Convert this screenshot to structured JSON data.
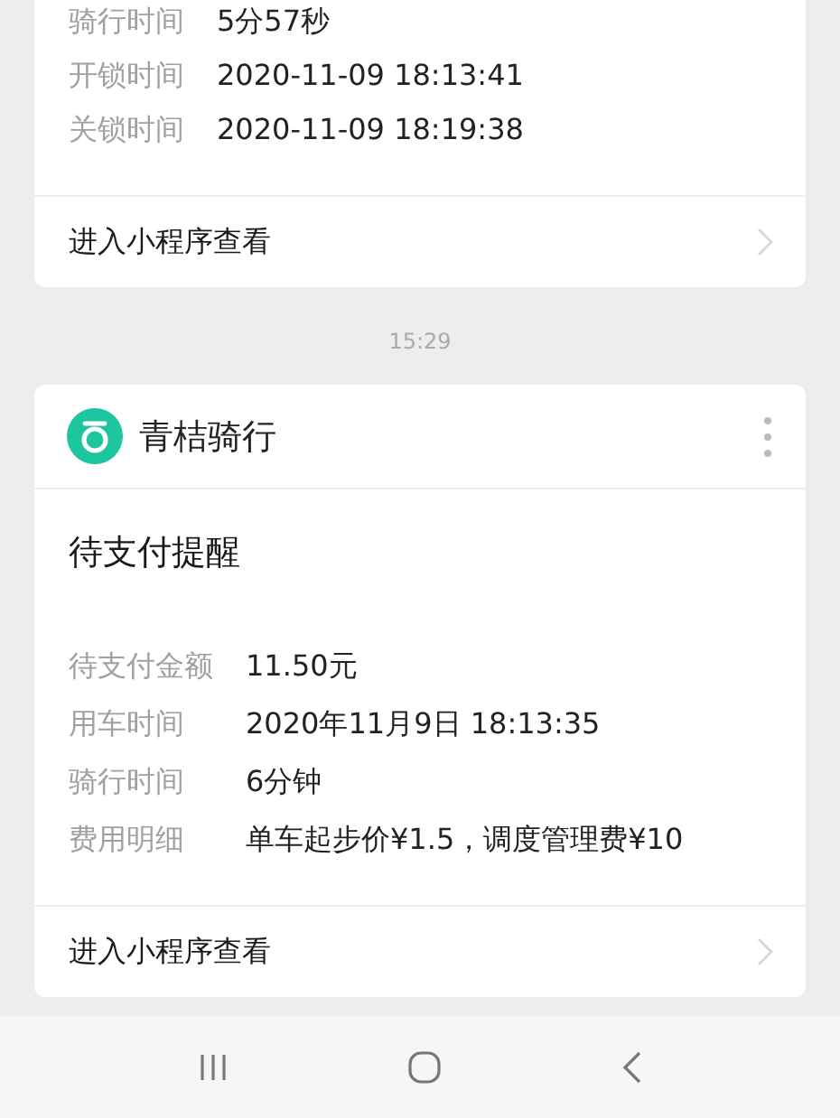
{
  "messages": [
    {
      "kind": "cut",
      "fields": [
        {
          "label": "骑行时间",
          "value": "5分57秒"
        },
        {
          "label": "开锁时间",
          "value": "2020-11-09 18:13:41"
        },
        {
          "label": "关锁时间",
          "value": "2020-11-09 18:19:38"
        }
      ],
      "link": "进入小程序查看"
    },
    {
      "kind": "time",
      "text": "15:29"
    },
    {
      "kind": "full",
      "app": "青桔骑行",
      "title": "待支付提醒",
      "fields": [
        {
          "label": "待支付金额",
          "value": "11.50元"
        },
        {
          "label": "用车时间",
          "value": "2020年11月9日 18:13:35"
        },
        {
          "label": "骑行时间",
          "value": "6分钟"
        },
        {
          "label": "费用明细",
          "value": "单车起步价¥1.5，调度管理费¥10"
        }
      ],
      "link": "进入小程序查看"
    }
  ]
}
